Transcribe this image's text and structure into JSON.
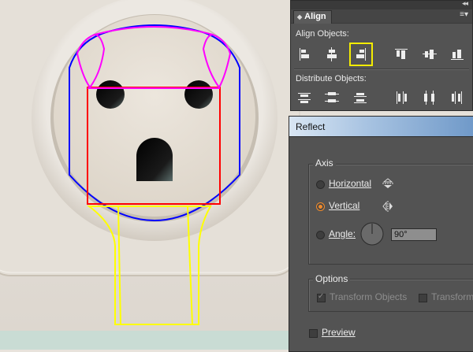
{
  "align_panel": {
    "tab_label": "Align",
    "align_objects_label": "Align Objects:",
    "distribute_objects_label": "Distribute Objects:",
    "align_buttons": [
      "horizontal-align-left",
      "horizontal-align-center",
      "horizontal-align-right",
      "vertical-align-top",
      "vertical-align-center",
      "vertical-align-bottom"
    ],
    "distribute_buttons": [
      "vertical-distribute-top",
      "vertical-distribute-center",
      "vertical-distribute-bottom",
      "horizontal-distribute-left",
      "horizontal-distribute-center",
      "horizontal-distribute-right"
    ],
    "selected_button": "horizontal-align-right"
  },
  "reflect_dialog": {
    "title": "Reflect",
    "axis_label": "Axis",
    "horizontal_label": "Horizontal",
    "vertical_label": "Vertical",
    "angle_label": "Angle:",
    "angle_value": "90°",
    "selected_axis": "vertical",
    "options_label": "Options",
    "transform_objects_label": "Transform Objects",
    "transform_patterns_label": "Transform",
    "transform_objects_checked": true,
    "transform_patterns_checked": false,
    "preview_label": "Preview",
    "preview_checked": false
  },
  "colors": {
    "panel_bg": "#535353",
    "highlight_yellow": "#f4ec00",
    "radio_accent": "#f28b2b",
    "guide_magenta": "#ff00ff",
    "guide_blue": "#0000ff",
    "guide_red": "#ff0000",
    "guide_yellow": "#ffff00"
  }
}
